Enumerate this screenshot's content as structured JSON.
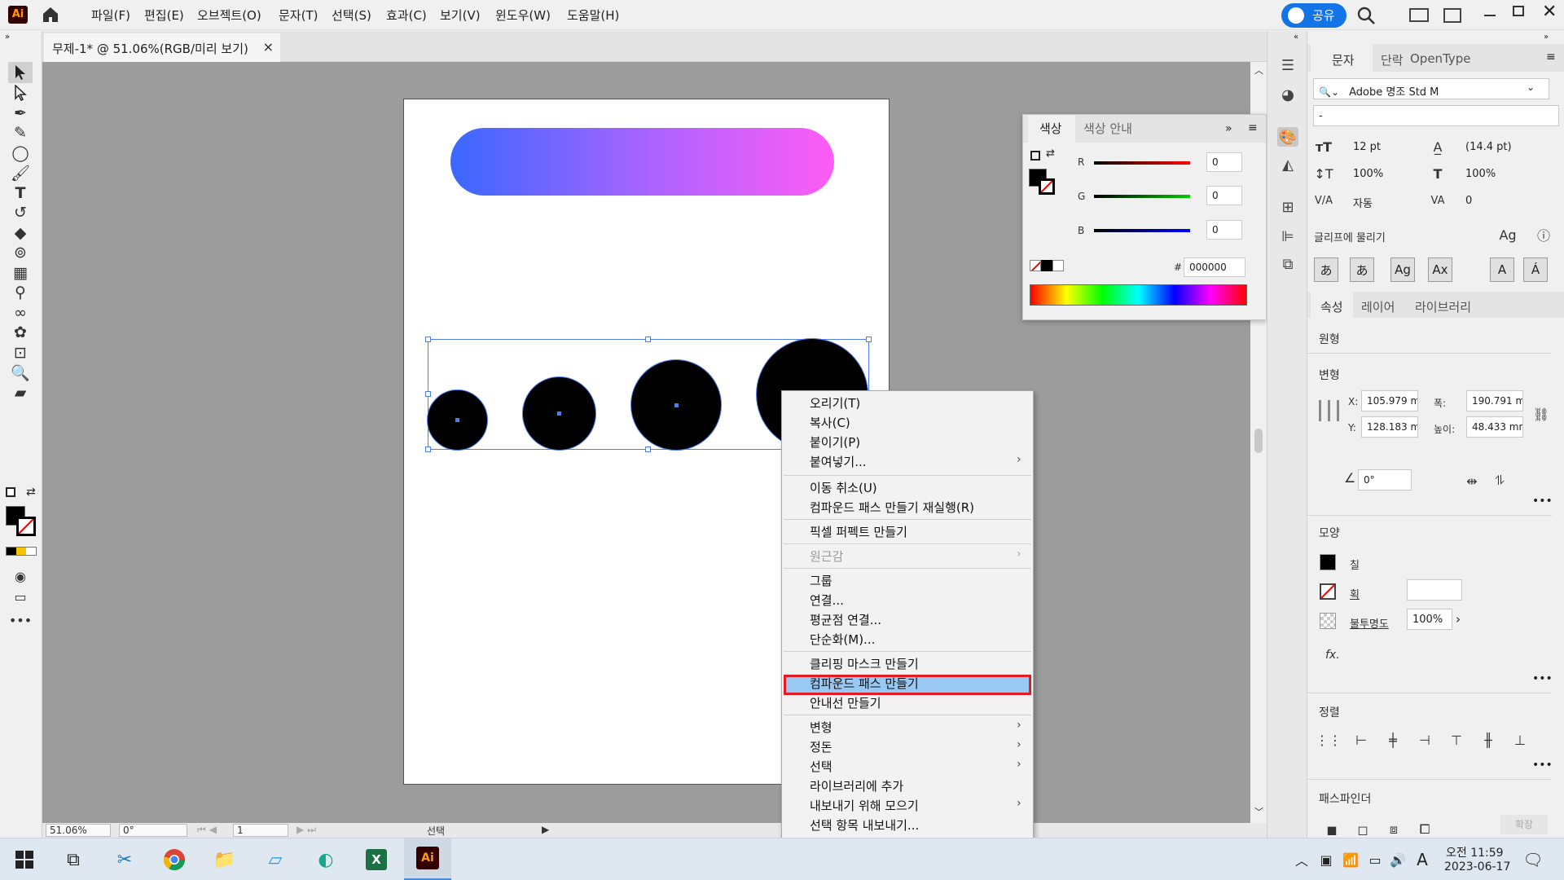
{
  "app": {
    "logo": "Ai"
  },
  "menubar": {
    "items": [
      "파일(F)",
      "편집(E)",
      "오브젝트(O)",
      "문자(T)",
      "선택(S)",
      "효과(C)",
      "보기(V)",
      "윈도우(W)",
      "도움말(H)"
    ],
    "share_label": "공유"
  },
  "document": {
    "tab_title": "무제-1* @ 51.06%(RGB/미리 보기)",
    "close_glyph": "×"
  },
  "statusbar": {
    "zoom": "51.06%",
    "rotation": "0°",
    "artboard": "1",
    "tool": "선택"
  },
  "color_panel": {
    "tabs": [
      "색상",
      "색상 안내"
    ],
    "channels": [
      {
        "label": "R",
        "value": "0",
        "color": "#e00000"
      },
      {
        "label": "G",
        "value": "0",
        "color": "#00c000"
      },
      {
        "label": "B",
        "value": "0",
        "color": "#0000e0"
      }
    ],
    "hex_label": "#",
    "hex_value": "000000"
  },
  "character_panel": {
    "tabs": [
      "문자",
      "단락",
      "OpenType"
    ],
    "font_family": "Adobe 명조 Std M",
    "font_style": "-",
    "font_size": "12 pt",
    "leading": "(14.4 pt)",
    "vertical_scale": "100%",
    "horizontal_scale": "100%",
    "kerning": "자동",
    "tracking": "0",
    "snap_label": "글리프에 물리기"
  },
  "properties_panel": {
    "tabs": [
      "속성",
      "레이어",
      "라이브러리"
    ],
    "object_type": "원형",
    "transform_title": "변형",
    "x_label": "X:",
    "x_value": "105.979 m",
    "y_label": "Y:",
    "y_value": "128.183 m",
    "w_label": "폭:",
    "w_value": "190.791 m",
    "h_label": "높이:",
    "h_value": "48.433 mn",
    "angle": "0°",
    "appearance_title": "모양",
    "fill_label": "칠",
    "stroke_label": "획",
    "opacity_label": "불투명도",
    "opacity_value": "100%",
    "fx_label": "fx.",
    "align_title": "정렬",
    "pathfinder_title": "패스파인더",
    "expand_label": "확장"
  },
  "context_menu": {
    "items": [
      {
        "label": "오리기(T)",
        "sub": false,
        "disabled": false
      },
      {
        "label": "복사(C)",
        "sub": false,
        "disabled": false
      },
      {
        "label": "붙이기(P)",
        "sub": false,
        "disabled": false
      },
      {
        "label": "붙여넣기...",
        "sub": true,
        "disabled": false
      },
      {
        "label": "이동 취소(U)",
        "sub": false,
        "disabled": false
      },
      {
        "label": "컴파운드 패스 만들기 재실행(R)",
        "sub": false,
        "disabled": false
      },
      {
        "label": "픽셀 퍼펙트 만들기",
        "sub": false,
        "disabled": false
      },
      {
        "label": "원근감",
        "sub": true,
        "disabled": true
      },
      {
        "label": "그룹",
        "sub": false,
        "disabled": false
      },
      {
        "label": "연결...",
        "sub": false,
        "disabled": false
      },
      {
        "label": "평균점 연결...",
        "sub": false,
        "disabled": false
      },
      {
        "label": "단순화(M)...",
        "sub": false,
        "disabled": false
      },
      {
        "label": "클리핑 마스크 만들기",
        "sub": false,
        "disabled": false
      },
      {
        "label": "컴파운드 패스 만들기",
        "sub": false,
        "disabled": false,
        "highlighted": true
      },
      {
        "label": "안내선 만들기",
        "sub": false,
        "disabled": false
      },
      {
        "label": "변형",
        "sub": true,
        "disabled": false
      },
      {
        "label": "정돈",
        "sub": true,
        "disabled": false
      },
      {
        "label": "선택",
        "sub": true,
        "disabled": false
      },
      {
        "label": "라이브러리에 추가",
        "sub": false,
        "disabled": false
      },
      {
        "label": "내보내기 위해 모으기",
        "sub": true,
        "disabled": false
      },
      {
        "label": "선택 항목 내보내기...",
        "sub": false,
        "disabled": false
      }
    ],
    "sub_arrow": "›"
  },
  "taskbar": {
    "clock_time": "오전 11:59",
    "clock_date": "2023-06-17",
    "ime": "A"
  },
  "colors": {
    "accent": "#1473e6",
    "selection": "#4e7df0",
    "highlight": "#99c9f3",
    "highlight_border": "#e51b24"
  }
}
